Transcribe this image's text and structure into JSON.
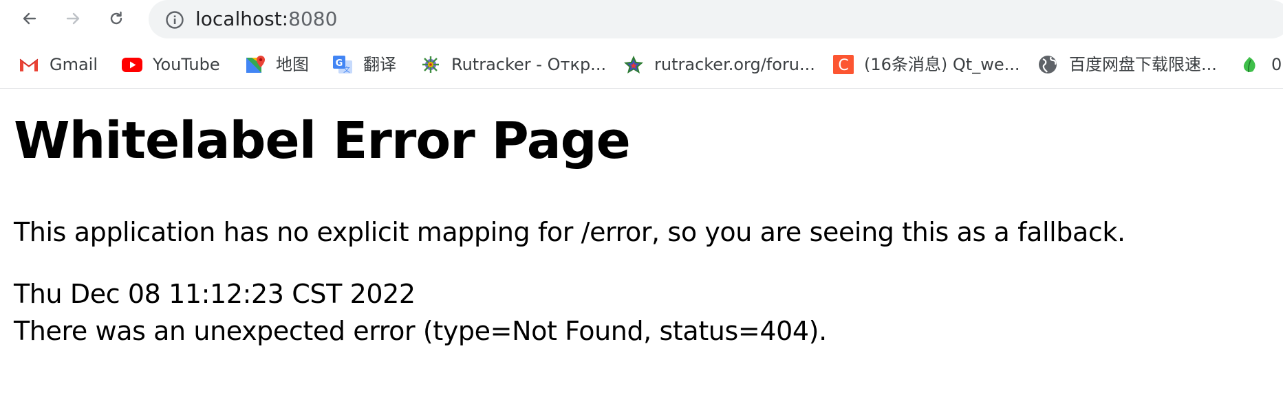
{
  "browser": {
    "url_host": "localhost:",
    "url_port": "8080",
    "accent_color": "#1ad27a"
  },
  "bookmarks": [
    {
      "label": "Gmail",
      "icon": "gmail-icon"
    },
    {
      "label": "YouTube",
      "icon": "youtube-icon"
    },
    {
      "label": "地图",
      "icon": "maps-icon"
    },
    {
      "label": "翻译",
      "icon": "translate-icon"
    },
    {
      "label": "Rutracker - Откр...",
      "icon": "rutracker-icon"
    },
    {
      "label": "rutracker.org/foru...",
      "icon": "star-icon"
    },
    {
      "label": "(16条消息) Qt_we...",
      "icon": "csdn-icon"
    },
    {
      "label": "百度网盘下载限速...",
      "icon": "globe-icon"
    },
    {
      "label": "0",
      "icon": "leaf-icon"
    }
  ],
  "page": {
    "title": "Whitelabel Error Page",
    "message": "This application has no explicit mapping for /error, so you are seeing this as a fallback.",
    "timestamp": "Thu Dec 08 11:12:23 CST 2022",
    "error": "There was an unexpected error (type=Not Found, status=404)."
  }
}
